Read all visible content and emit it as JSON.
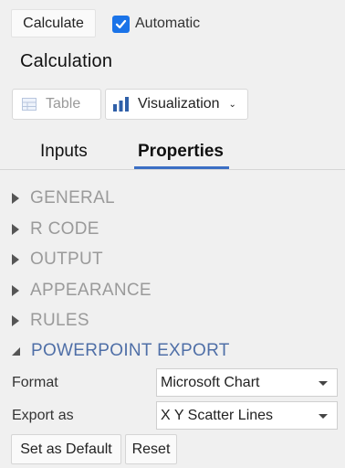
{
  "toolbar": {
    "calculate_label": "Calculate",
    "automatic_label": "Automatic",
    "automatic_checked": true
  },
  "title": "Calculation",
  "view_buttons": {
    "table_label": "Table",
    "visualization_label": "Visualization"
  },
  "tabs": [
    {
      "label": "Inputs",
      "active": false
    },
    {
      "label": "Properties",
      "active": true
    }
  ],
  "sections": [
    {
      "label": "GENERAL",
      "expanded": false
    },
    {
      "label": "R CODE",
      "expanded": false
    },
    {
      "label": "OUTPUT",
      "expanded": false
    },
    {
      "label": "APPEARANCE",
      "expanded": false
    },
    {
      "label": "RULES",
      "expanded": false
    },
    {
      "label": "POWERPOINT EXPORT",
      "expanded": true
    }
  ],
  "powerpoint_export": {
    "format_label": "Format",
    "format_value": "Microsoft Chart",
    "export_as_label": "Export as",
    "export_as_value": "X Y Scatter Lines"
  },
  "footer": {
    "set_default_label": "Set as Default",
    "reset_label": "Reset"
  },
  "colors": {
    "accent": "#3b6fc4",
    "checkbox": "#1a73e8",
    "active_section": "#4f6fa7"
  }
}
